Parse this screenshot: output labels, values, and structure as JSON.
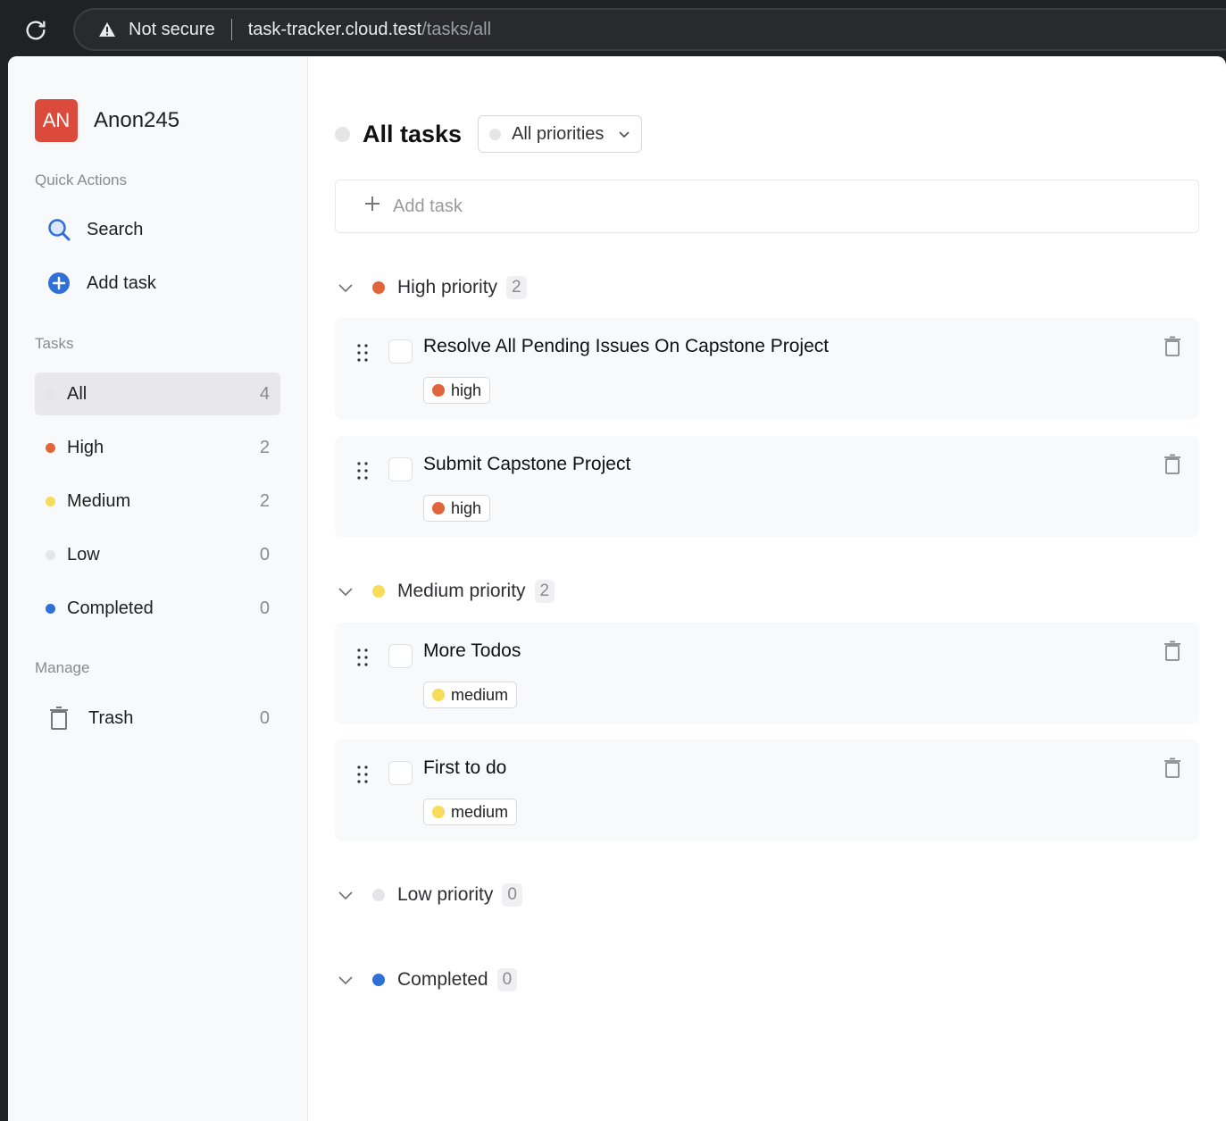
{
  "browser": {
    "security_label": "Not secure",
    "url_host": "task-tracker.cloud.test",
    "url_path": "/tasks/all"
  },
  "colors": {
    "high": "#e0653a",
    "medium": "#f6dc5a",
    "low": "#e5e5e8",
    "completed": "#2f6fd6",
    "avatar": "#dc4a3b"
  },
  "sidebar": {
    "user": {
      "initials": "AN",
      "name": "Anon245"
    },
    "quick_actions_label": "Quick Actions",
    "quick_actions": [
      {
        "label": "Search",
        "icon": "search-icon"
      },
      {
        "label": "Add task",
        "icon": "add-circle-icon"
      }
    ],
    "tasks_label": "Tasks",
    "filters": [
      {
        "label": "All",
        "count": "4",
        "active": true
      },
      {
        "label": "High",
        "count": "2"
      },
      {
        "label": "Medium",
        "count": "2"
      },
      {
        "label": "Low",
        "count": "0"
      },
      {
        "label": "Completed",
        "count": "0"
      }
    ],
    "manage_label": "Manage",
    "manage": [
      {
        "label": "Trash",
        "count": "0",
        "icon": "trash-icon"
      }
    ]
  },
  "main": {
    "title": "All tasks",
    "priority_select": "All priorities",
    "add_task_placeholder": "Add task",
    "groups": [
      {
        "label": "High priority",
        "count": "2",
        "tasks": [
          {
            "title": "Resolve All Pending Issues On Capstone Project",
            "tag": "high"
          },
          {
            "title": "Submit Capstone Project",
            "tag": "high"
          }
        ]
      },
      {
        "label": "Medium priority",
        "count": "2",
        "tasks": [
          {
            "title": "More Todos",
            "tag": "medium"
          },
          {
            "title": "First to do",
            "tag": "medium"
          }
        ]
      },
      {
        "label": "Low priority",
        "count": "0",
        "tasks": []
      },
      {
        "label": "Completed",
        "count": "0",
        "tasks": []
      }
    ]
  }
}
